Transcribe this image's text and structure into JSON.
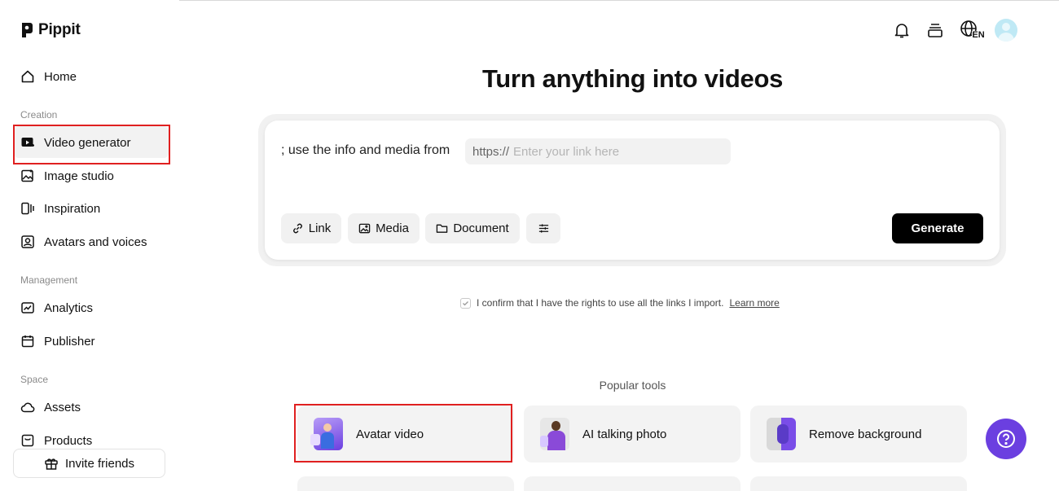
{
  "app": {
    "name": "Pippit"
  },
  "sidebar": {
    "home": "Home",
    "sections": {
      "creation": "Creation",
      "management": "Management",
      "space": "Space"
    },
    "items": {
      "video_generator": "Video generator",
      "image_studio": "Image studio",
      "inspiration": "Inspiration",
      "avatars_voices": "Avatars and voices",
      "analytics": "Analytics",
      "publisher": "Publisher",
      "assets": "Assets",
      "products": "Products"
    },
    "invite": "Invite friends",
    "active_item": "Video generator"
  },
  "header": {
    "language": "EN",
    "icons": [
      "bell-icon",
      "layers-icon",
      "globe-language-icon",
      "user-avatar"
    ]
  },
  "main": {
    "title": "Turn anything into videos",
    "prompt_text": "; use the info and media from",
    "link_input": {
      "prefix": "https://",
      "placeholder": "Enter your link here"
    },
    "chips": {
      "link": "Link",
      "media": "Media",
      "document": "Document"
    },
    "generate": "Generate",
    "confirm": {
      "text": "I confirm that I have the rights to use all the links I import.",
      "link": "Learn more",
      "checked": true
    }
  },
  "popular": {
    "heading": "Popular tools",
    "tools": [
      "Avatar video",
      "AI talking photo",
      "Remove background"
    ]
  },
  "colors": {
    "accent": "#6b3fe0",
    "highlight": "#e02020",
    "generate": "#000000"
  }
}
